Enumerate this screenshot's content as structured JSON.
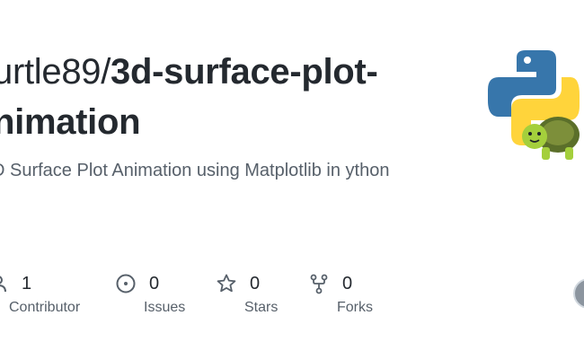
{
  "repo": {
    "owner": "urtle89/",
    "name_line1": "3d-surface-plot-",
    "name_line2": "nimation",
    "description": "D Surface Plot Animation using Matplotlib in ython"
  },
  "stats": [
    {
      "count": "1",
      "label": "Contributor",
      "icon": "people-icon"
    },
    {
      "count": "0",
      "label": "Issues",
      "icon": "issue-icon"
    },
    {
      "count": "0",
      "label": "Stars",
      "icon": "star-icon"
    },
    {
      "count": "0",
      "label": "Forks",
      "icon": "fork-icon"
    }
  ],
  "colors": {
    "text": "#24292f",
    "muted": "#57606a",
    "python_blue": "#3776ab",
    "python_yellow": "#ffd43b",
    "turtle_green": "#9acd32"
  }
}
